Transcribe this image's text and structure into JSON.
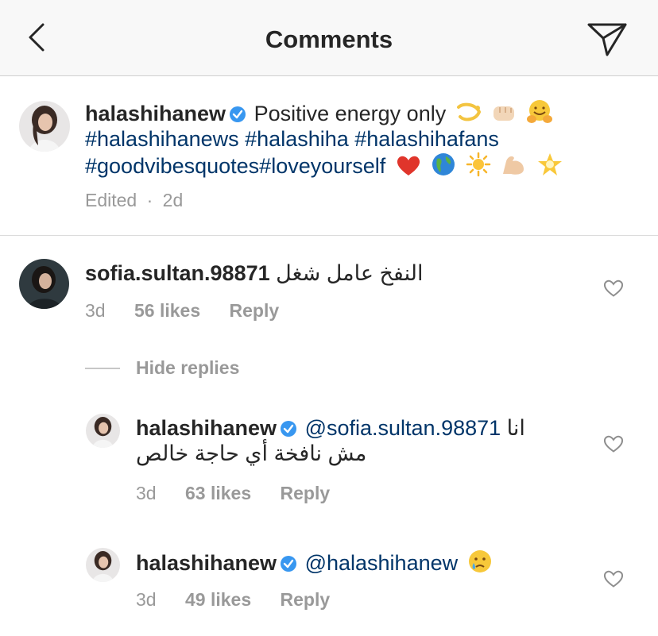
{
  "header": {
    "title": "Comments"
  },
  "caption": {
    "username": "halashihanew",
    "text": "Positive energy only",
    "hashtags_line1": "#halashihanews #halashiha #halashihafans",
    "hashtags_line2": "#goodvibesquotes#loveyourself",
    "edited": "Edited",
    "time": "2d"
  },
  "comments": [
    {
      "username": "sofia.sultan.98871",
      "text": "النفخ عامل شغل",
      "time": "3d",
      "likes": "56 likes",
      "reply": "Reply"
    }
  ],
  "hide_replies": "Hide replies",
  "replies": [
    {
      "username": "halashihanew",
      "mention": "@sofia.sultan.98871",
      "text_line1": "انا",
      "text_line2": "مش نافخة أي حاجة خالص",
      "time": "3d",
      "likes": "63 likes",
      "reply": "Reply"
    },
    {
      "username": "halashihanew",
      "mention": "@halashihanew",
      "time": "3d",
      "likes": "49 likes",
      "reply": "Reply"
    }
  ],
  "icons": {
    "back": "chevron-left-icon",
    "send": "paper-plane-icon",
    "like": "heart-outline-icon",
    "verified": "verified-badge-icon"
  },
  "colors": {
    "hashtag": "#003569",
    "verified": "#3897f0",
    "muted": "#999999"
  }
}
